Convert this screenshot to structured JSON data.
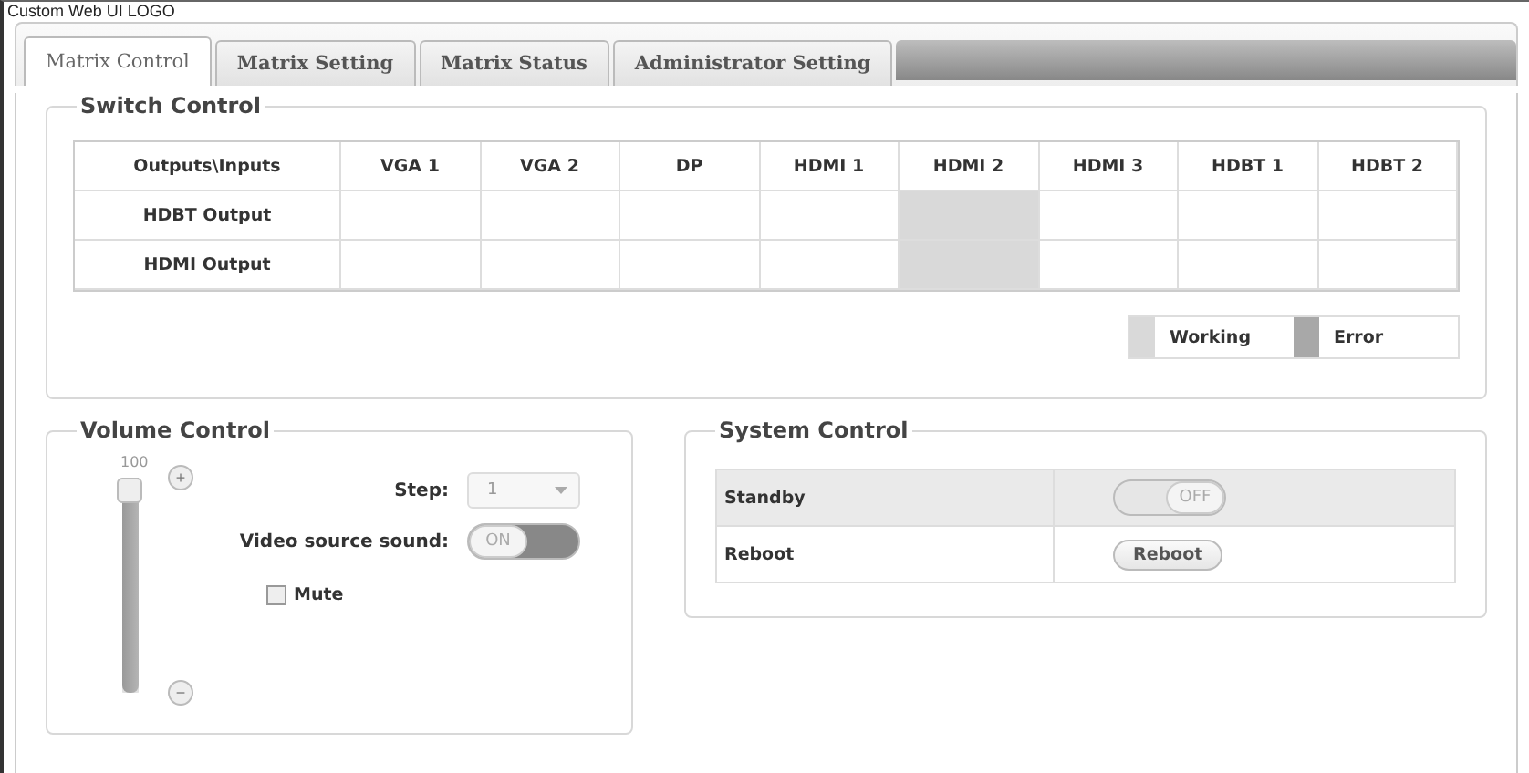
{
  "header": {
    "logo": "Custom Web UI LOGO"
  },
  "tabs": [
    {
      "label": "Matrix Control",
      "selected": true
    },
    {
      "label": "Matrix Setting",
      "selected": false
    },
    {
      "label": "Matrix Status",
      "selected": false
    },
    {
      "label": "Administrator Setting",
      "selected": false
    }
  ],
  "switch_control": {
    "title": "Switch Control",
    "corner": "Outputs\\Inputs",
    "columns": [
      "VGA 1",
      "VGA 2",
      "DP",
      "HDMI 1",
      "HDMI 2",
      "HDMI 3",
      "HDBT 1",
      "HDBT 2"
    ],
    "rows": [
      {
        "label": "HDBT Output",
        "cells": [
          {
            "selected": false
          },
          {
            "selected": false
          },
          {
            "selected": false
          },
          {
            "selected": false
          },
          {
            "selected": true
          },
          {
            "selected": false
          },
          {
            "selected": false
          },
          {
            "selected": false
          }
        ]
      },
      {
        "label": "HDMI Output",
        "cells": [
          {
            "selected": false
          },
          {
            "selected": false
          },
          {
            "selected": false
          },
          {
            "selected": false
          },
          {
            "selected": true
          },
          {
            "selected": false
          },
          {
            "selected": false
          },
          {
            "selected": false
          }
        ]
      }
    ],
    "legend": [
      {
        "label": "Working",
        "color": "#d9d9d9"
      },
      {
        "label": "Error",
        "color": "#a8a8a8"
      }
    ]
  },
  "volume_control": {
    "title": "Volume Control",
    "slider_value": "100",
    "level": 1,
    "plus": "+",
    "minus": "−",
    "step_label": "Step:",
    "step_value": "1",
    "video_sound_label": "Video source sound:",
    "video_sound": {
      "on": true,
      "label": "ON"
    },
    "mute": {
      "label": "Mute",
      "checked": false
    }
  },
  "system_control": {
    "title": "System Control",
    "rows": [
      {
        "kind": "toggle",
        "label": "Standby",
        "on": false,
        "text": "OFF"
      },
      {
        "kind": "button",
        "label": "Reboot",
        "text": "Reboot"
      }
    ]
  }
}
